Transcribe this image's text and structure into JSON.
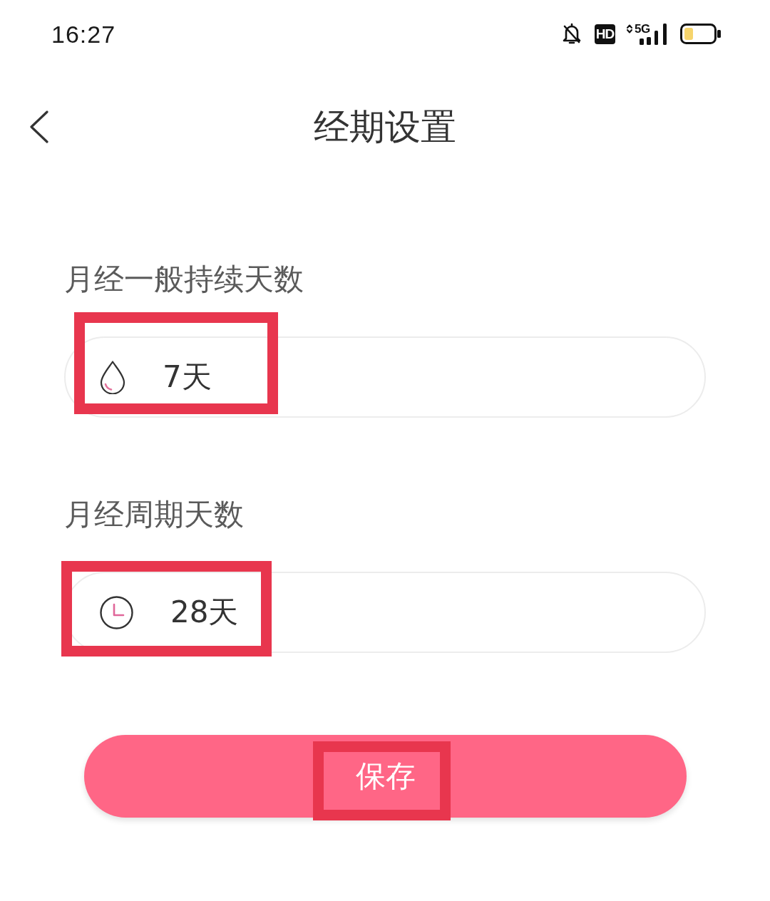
{
  "status_bar": {
    "time": "16:27",
    "hd": "HD",
    "network": "5G"
  },
  "header": {
    "title": "经期设置"
  },
  "fields": [
    {
      "kind": "period",
      "label": "月经一般持续天数",
      "value": "7天",
      "highlighted": true
    },
    {
      "kind": "cycle",
      "label": "月经周期天数",
      "value": "28天",
      "highlighted": true
    }
  ],
  "save_button": {
    "label": "保存",
    "highlighted": true
  }
}
